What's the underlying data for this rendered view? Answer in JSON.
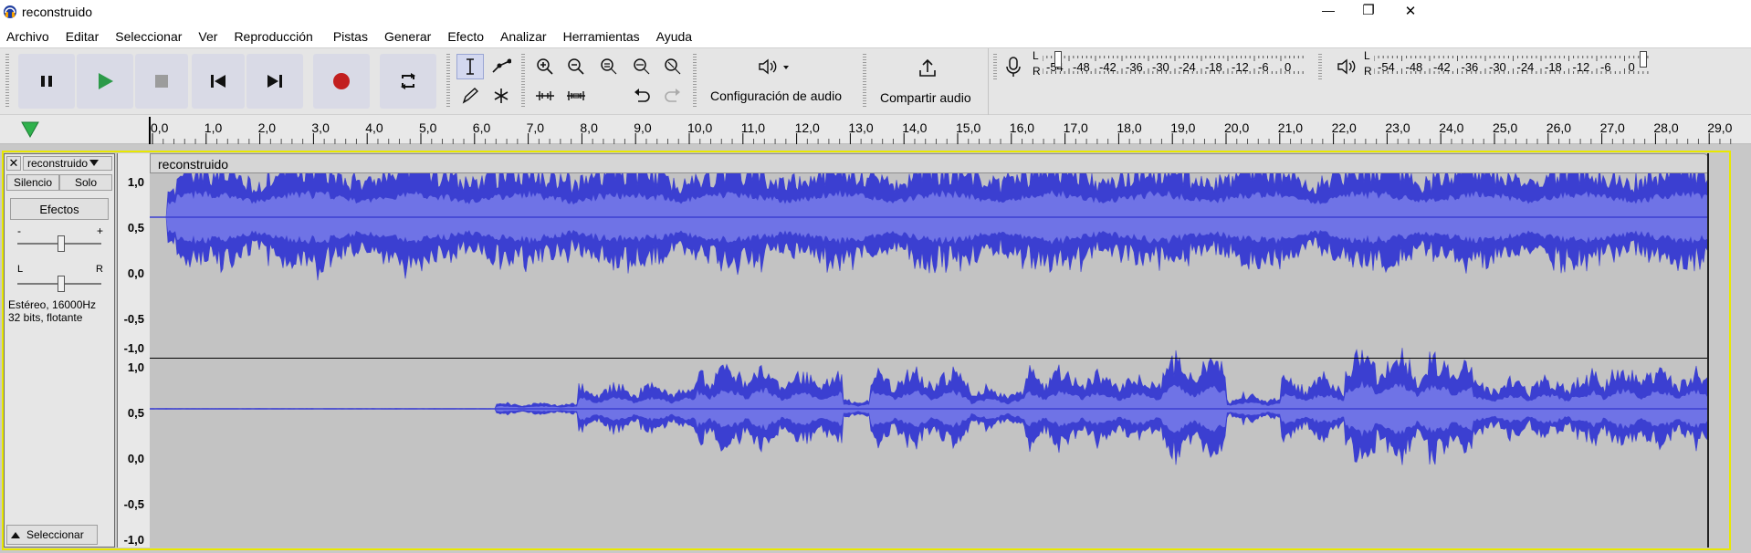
{
  "window": {
    "title": "reconstruido",
    "min": "—",
    "max": "❐",
    "close": "✕"
  },
  "menu": [
    "Archivo",
    "Editar",
    "Seleccionar",
    "Ver",
    "Reproducción",
    "Pistas",
    "Generar",
    "Efecto",
    "Analizar",
    "Herramientas",
    "Ayuda"
  ],
  "toolbar": {
    "audio_setup_label": "Configuración de audio",
    "share_label": "Compartir audio",
    "rec_meter_scale": [
      "-54",
      "-48",
      "-42",
      "-36",
      "-30",
      "-24",
      "-18",
      "-12",
      "-6",
      "0"
    ],
    "play_meter_scale": [
      "-54",
      "-48",
      "-42",
      "-36",
      "-30",
      "-24",
      "-18",
      "-12",
      "-6",
      "0"
    ],
    "rec_channels": [
      "L",
      "R"
    ],
    "play_channels": [
      "L",
      "R"
    ]
  },
  "ruler": {
    "ticks": [
      "0,0",
      "1,0",
      "2,0",
      "3,0",
      "4,0",
      "5,0",
      "6,0",
      "7,0",
      "8,0",
      "9,0",
      "10,0",
      "11,0",
      "12,0",
      "13,0",
      "14,0",
      "15,0",
      "16,0",
      "17,0",
      "18,0",
      "19,0",
      "20,0",
      "21,0",
      "22,0",
      "23,0",
      "24,0",
      "25,0",
      "26,0",
      "27,0",
      "28,0",
      "29,0"
    ]
  },
  "track": {
    "name": "reconstruido",
    "clip_name": "reconstruido",
    "mute_label": "Silencio",
    "solo_label": "Solo",
    "effects_label": "Efectos",
    "gain_minus": "-",
    "gain_plus": "+",
    "pan_left": "L",
    "pan_right": "R",
    "info_line1": "Estéreo, 16000Hz",
    "info_line2": "32 bits, flotante",
    "select_label": "Seleccionar",
    "scale_labels": [
      "1,0",
      "0,5",
      "0,0",
      "-0,5",
      "-1,0"
    ]
  },
  "colors": {
    "wave_peak": "#3b3fd1",
    "wave_rms": "#6f73e6",
    "background": "#c3c3c3",
    "selection_border": "#e8e800",
    "play_head": "#2fb24c",
    "record": "#c21f1f"
  }
}
